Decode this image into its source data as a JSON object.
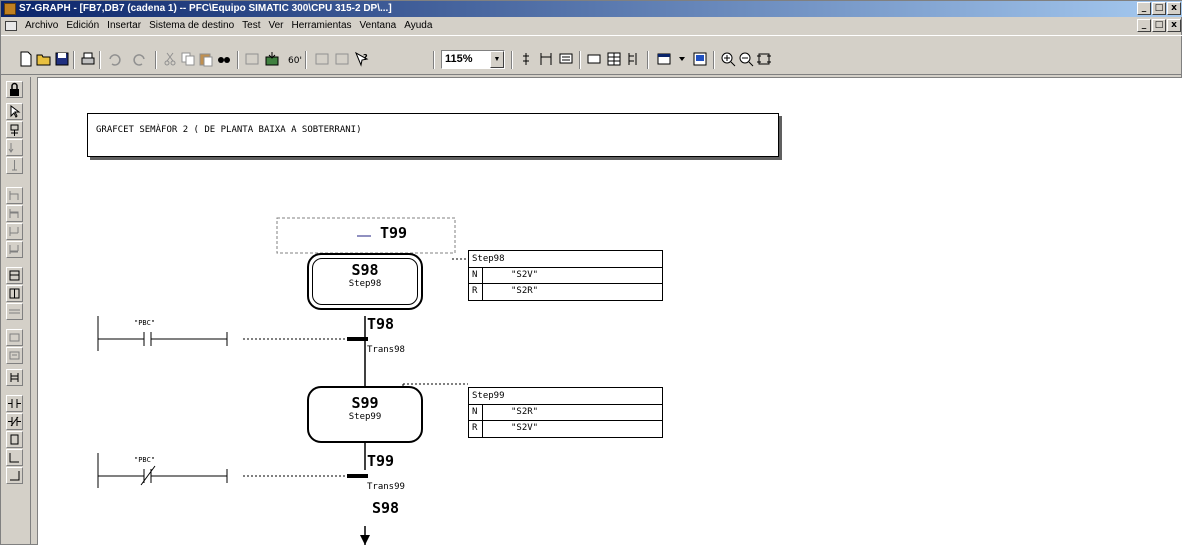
{
  "window": {
    "title": "S7-GRAPH - [FB7,DB7 (cadena 1) -- PFC\\Equipo SIMATIC 300\\CPU 315-2 DP\\...]",
    "controls": [
      "_",
      "□",
      "x"
    ]
  },
  "menu": {
    "items": [
      "Archivo",
      "Edición",
      "Insertar",
      "Sistema de destino",
      "Test",
      "Ver",
      "Herramientas",
      "Ventana",
      "Ayuda"
    ]
  },
  "toolbar": {
    "zoom": "115%",
    "buttons": [
      "new-icon",
      "open-icon",
      "save-icon",
      "print-icon",
      "undo-icon",
      "redo-icon",
      "cut-icon",
      "copy-icon",
      "paste-icon",
      "find-icon",
      "compile-icon",
      "download-icon",
      "monitor-icon",
      "help-icon",
      "step-icon",
      "transition-icon",
      "branch-icon",
      "comment-icon",
      "table-icon",
      "zoom-in-icon",
      "zoom-out-icon",
      "fit-icon"
    ]
  },
  "graph": {
    "comment": "GRAFCET SEMÀFOR 2 ( DE PLANTA BAIXA A SOBTERRANI)",
    "jump_in": "T99",
    "steps": [
      {
        "name": "S98",
        "sub": "Step98",
        "initial": true,
        "actions_title": "Step98",
        "actions": [
          {
            "q": "N",
            "op": "\"S2V\""
          },
          {
            "q": "R",
            "op": "\"S2R\""
          }
        ]
      },
      {
        "name": "S99",
        "sub": "Step99",
        "initial": false,
        "actions_title": "Step99",
        "actions": [
          {
            "q": "N",
            "op": "\"S2R\""
          },
          {
            "q": "R",
            "op": "\"S2V\""
          }
        ]
      }
    ],
    "transitions": [
      {
        "name": "T98",
        "sub": "Trans98",
        "contact_label": "\"PBC\"",
        "contact": "NO"
      },
      {
        "name": "T99",
        "sub": "Trans99",
        "contact_label": "\"PBC\"",
        "contact": "NC"
      }
    ],
    "jump_out": "S98"
  }
}
